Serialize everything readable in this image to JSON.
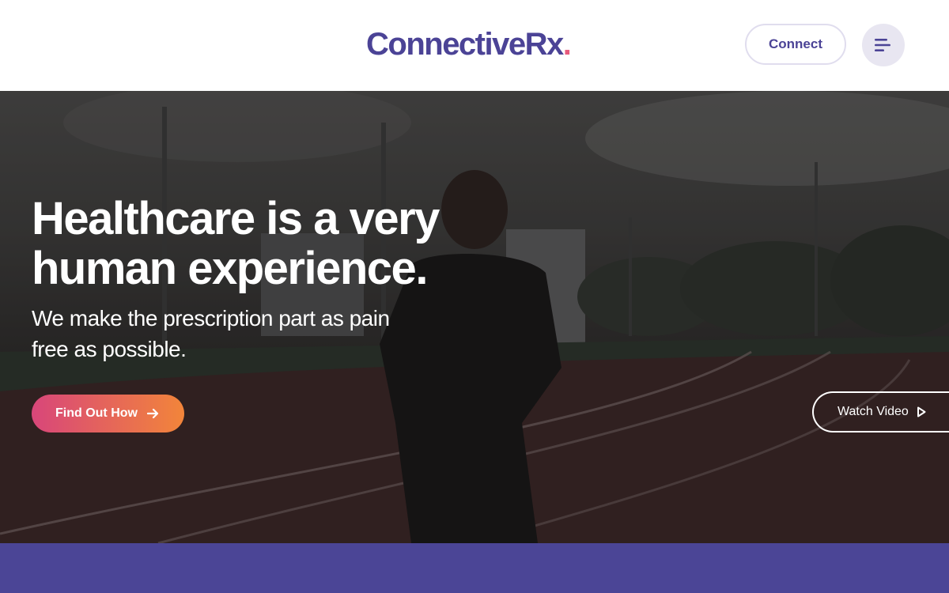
{
  "header": {
    "logo_text": "ConnectiveRx",
    "logo_dot": ".",
    "connect_label": "Connect",
    "menu_icon": "hamburger-menu-icon"
  },
  "hero": {
    "headline": "Healthcare is a very human experience.",
    "subhead": "We make the prescription part as pain free as possible.",
    "cta_label": "Find Out How",
    "cta_icon": "arrow-right-icon",
    "watch_label": "Watch Video",
    "watch_icon": "play-icon"
  },
  "colors": {
    "brand_purple": "#4b4396",
    "band_purple": "#4b4596",
    "cta_gradient_start": "#d8467a",
    "cta_gradient_end": "#f2853a"
  }
}
